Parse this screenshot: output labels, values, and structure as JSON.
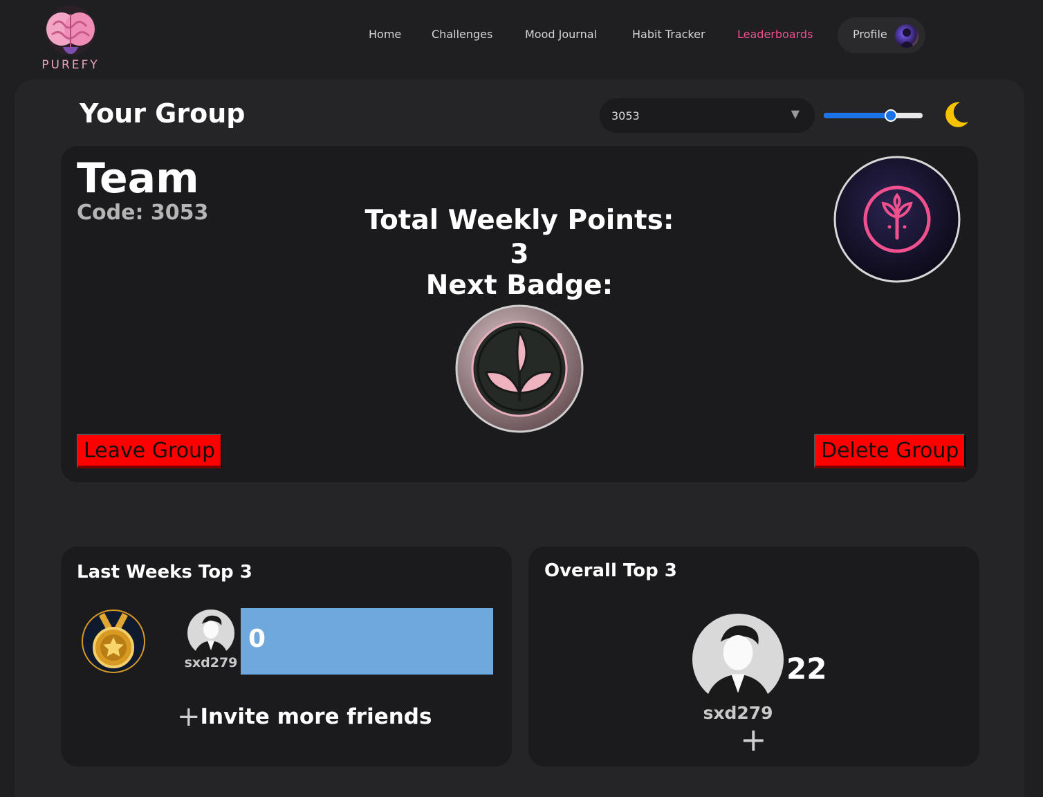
{
  "brand": {
    "name": "PUREFY"
  },
  "nav": {
    "items": [
      "Home",
      "Challenges",
      "Mood Journal",
      "Habit Tracker",
      "Leaderboards"
    ],
    "active": "Leaderboards",
    "profile_label": "Profile"
  },
  "group_header": {
    "title": "Your Group",
    "selected_group": "3053",
    "slider_level": 0.68,
    "theme_icon": "moon-icon"
  },
  "team": {
    "name": "Team",
    "code_label": "Code: 3053",
    "weekly_points_label": "Total Weekly Points:",
    "weekly_points_value": "3",
    "next_badge_label": "Next Badge:",
    "leave_label": "Leave Group",
    "delete_label": "Delete Group"
  },
  "last_week": {
    "title": "Last Weeks Top 3",
    "entries": [
      {
        "username": "sxd279",
        "score": "0"
      }
    ],
    "invite_label": "Invite more friends"
  },
  "overall": {
    "title": "Overall Top 3",
    "entries": [
      {
        "username": "sxd279",
        "score": "22"
      }
    ]
  },
  "colors": {
    "accent_pink": "#f0518e",
    "danger_red": "#ff0000",
    "bar_blue": "#6fa8dc",
    "slider_blue": "#1a73e8",
    "moon_yellow": "#f7c300"
  }
}
